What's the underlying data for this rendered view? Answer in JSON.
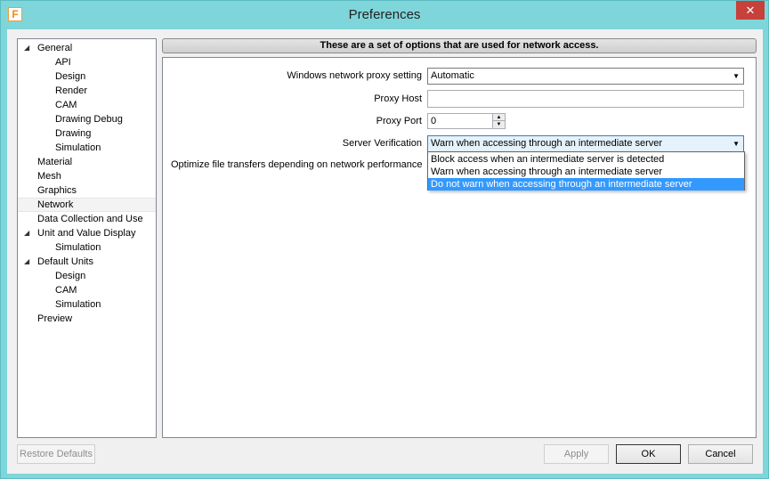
{
  "window": {
    "title": "Preferences",
    "app_icon_letter": "F"
  },
  "tree": {
    "items": [
      {
        "label": "General",
        "depth": 0,
        "expanded": true
      },
      {
        "label": "API",
        "depth": 1
      },
      {
        "label": "Design",
        "depth": 1
      },
      {
        "label": "Render",
        "depth": 1
      },
      {
        "label": "CAM",
        "depth": 1
      },
      {
        "label": "Drawing Debug",
        "depth": 1
      },
      {
        "label": "Drawing",
        "depth": 1
      },
      {
        "label": "Simulation",
        "depth": 1
      },
      {
        "label": "Material",
        "depth": 0
      },
      {
        "label": "Mesh",
        "depth": 0
      },
      {
        "label": "Graphics",
        "depth": 0
      },
      {
        "label": "Network",
        "depth": 0,
        "selected": true
      },
      {
        "label": "Data Collection and Use",
        "depth": 0
      },
      {
        "label": "Unit and Value Display",
        "depth": 0,
        "expanded": true
      },
      {
        "label": "Simulation",
        "depth": 1
      },
      {
        "label": "Default Units",
        "depth": 0,
        "expanded": true
      },
      {
        "label": "Design",
        "depth": 1
      },
      {
        "label": "CAM",
        "depth": 1
      },
      {
        "label": "Simulation",
        "depth": 1
      },
      {
        "label": "Preview",
        "depth": 0
      }
    ]
  },
  "header": {
    "text": "These are a set of options that are used for network access."
  },
  "form": {
    "proxy_setting_label": "Windows network proxy setting",
    "proxy_setting_value": "Automatic",
    "proxy_host_label": "Proxy Host",
    "proxy_host_value": "",
    "proxy_port_label": "Proxy Port",
    "proxy_port_value": "0",
    "server_verification_label": "Server Verification",
    "server_verification_value": "Warn when accessing through an intermediate server",
    "optimize_label": "Optimize file transfers depending on network performance"
  },
  "dropdown": {
    "options": [
      "Block access when an intermediate server is detected",
      "Warn when accessing through an intermediate server",
      "Do not warn when accessing through an intermediate server"
    ],
    "highlighted_index": 2
  },
  "buttons": {
    "restore": "Restore Defaults",
    "apply": "Apply",
    "ok": "OK",
    "cancel": "Cancel"
  },
  "colors": {
    "selection": "#3399ff",
    "titlebar": "#7fd6da",
    "close": "#c7403a"
  }
}
